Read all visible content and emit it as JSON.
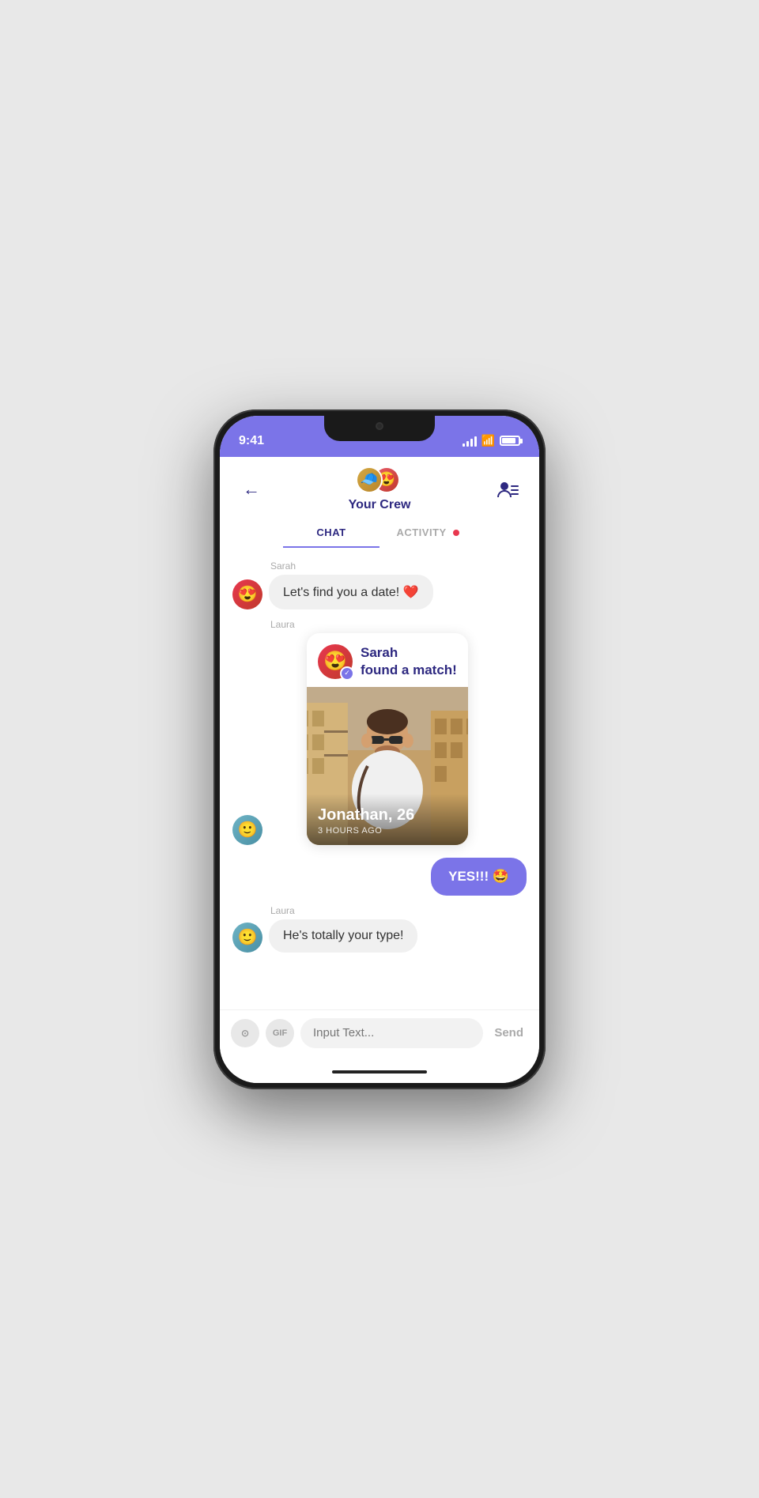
{
  "status_bar": {
    "time": "9:41",
    "signal": "signal-icon",
    "wifi": "wifi-icon",
    "battery": "battery-icon"
  },
  "header": {
    "back_label": "←",
    "title": "Your Crew",
    "contacts_icon": "contacts-icon"
  },
  "tabs": [
    {
      "label": "CHAT",
      "active": true,
      "dot": false
    },
    {
      "label": "ACTIVITY",
      "active": false,
      "dot": true
    }
  ],
  "messages": [
    {
      "sender": "Sarah",
      "type": "incoming",
      "avatar": "😍",
      "text": "Let's find you a date! ❤️"
    },
    {
      "sender": "Laura",
      "type": "match-card",
      "avatar": "😊",
      "match_header": "Sarah\nfound a match!",
      "match_name": "Jonathan, 26",
      "match_time": "3 HOURS AGO"
    },
    {
      "sender": "me",
      "type": "outgoing",
      "text": "YES!!! 🤩"
    },
    {
      "sender": "Laura",
      "type": "incoming",
      "avatar": "😊",
      "text": "He's totally your type!"
    }
  ],
  "input_bar": {
    "camera_label": "📷",
    "gif_label": "GIF",
    "placeholder": "Input Text...",
    "send_label": "Send"
  }
}
